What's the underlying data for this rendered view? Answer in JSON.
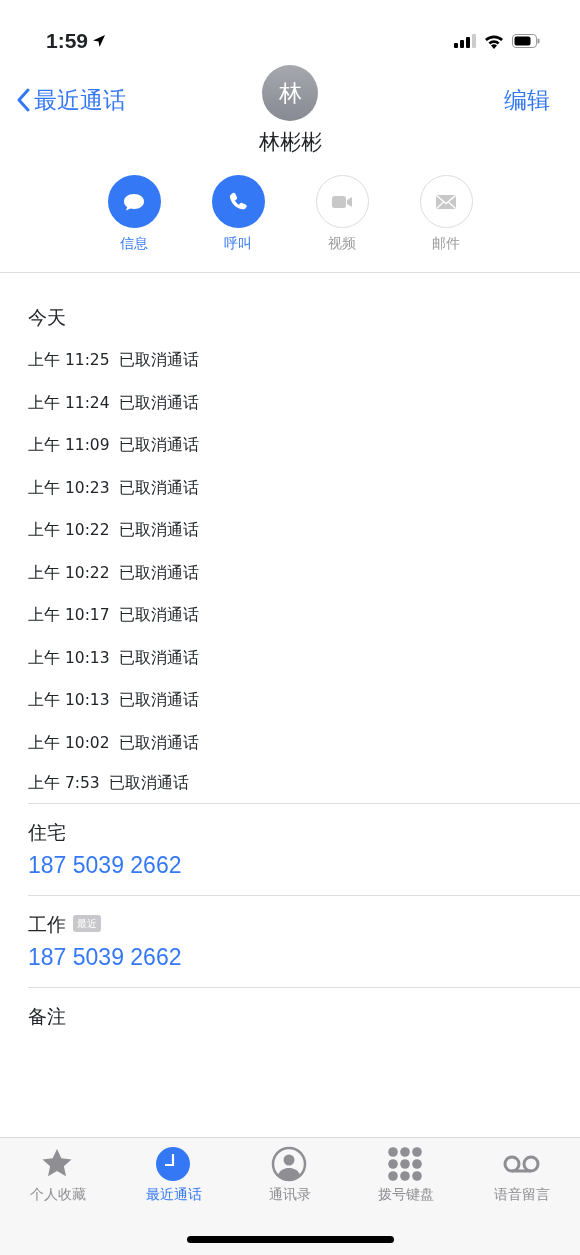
{
  "status_bar": {
    "time": "1:59"
  },
  "nav": {
    "back_label": "最近通话",
    "edit_label": "编辑"
  },
  "contact": {
    "initial": "林",
    "name": "林彬彬"
  },
  "actions": [
    {
      "kind": "message",
      "label": "信息",
      "disabled": false
    },
    {
      "kind": "call",
      "label": "呼叫",
      "disabled": false
    },
    {
      "kind": "video",
      "label": "视频",
      "disabled": true
    },
    {
      "kind": "mail",
      "label": "邮件",
      "disabled": true
    }
  ],
  "call_log": {
    "heading": "今天",
    "entries": [
      {
        "time": "上午 11:25",
        "status": "已取消通话"
      },
      {
        "time": "上午 11:24",
        "status": "已取消通话"
      },
      {
        "time": "上午 11:09",
        "status": "已取消通话"
      },
      {
        "time": "上午 10:23",
        "status": "已取消通话"
      },
      {
        "time": "上午 10:22",
        "status": "已取消通话"
      },
      {
        "time": "上午 10:22",
        "status": "已取消通话"
      },
      {
        "time": "上午 10:17",
        "status": "已取消通话"
      },
      {
        "time": "上午 10:13",
        "status": "已取消通话"
      },
      {
        "time": "上午 10:13",
        "status": "已取消通话"
      },
      {
        "time": "上午 10:02",
        "status": "已取消通话"
      },
      {
        "time": "上午 7:53",
        "status": "已取消通话"
      }
    ]
  },
  "phones": [
    {
      "label": "住宅",
      "number": "187 5039 2662"
    },
    {
      "label": "工作",
      "badge": "最近",
      "number": "187 5039 2662"
    }
  ],
  "notes": {
    "label": "备注"
  },
  "tab_bar": [
    {
      "kind": "favorites",
      "label": "个人收藏",
      "selected": false
    },
    {
      "kind": "recents",
      "label": "最近通话",
      "selected": true
    },
    {
      "kind": "contacts",
      "label": "通讯录",
      "selected": false
    },
    {
      "kind": "keypad",
      "label": "拨号键盘",
      "selected": false
    },
    {
      "kind": "voicemail",
      "label": "语音留言",
      "selected": false
    }
  ]
}
